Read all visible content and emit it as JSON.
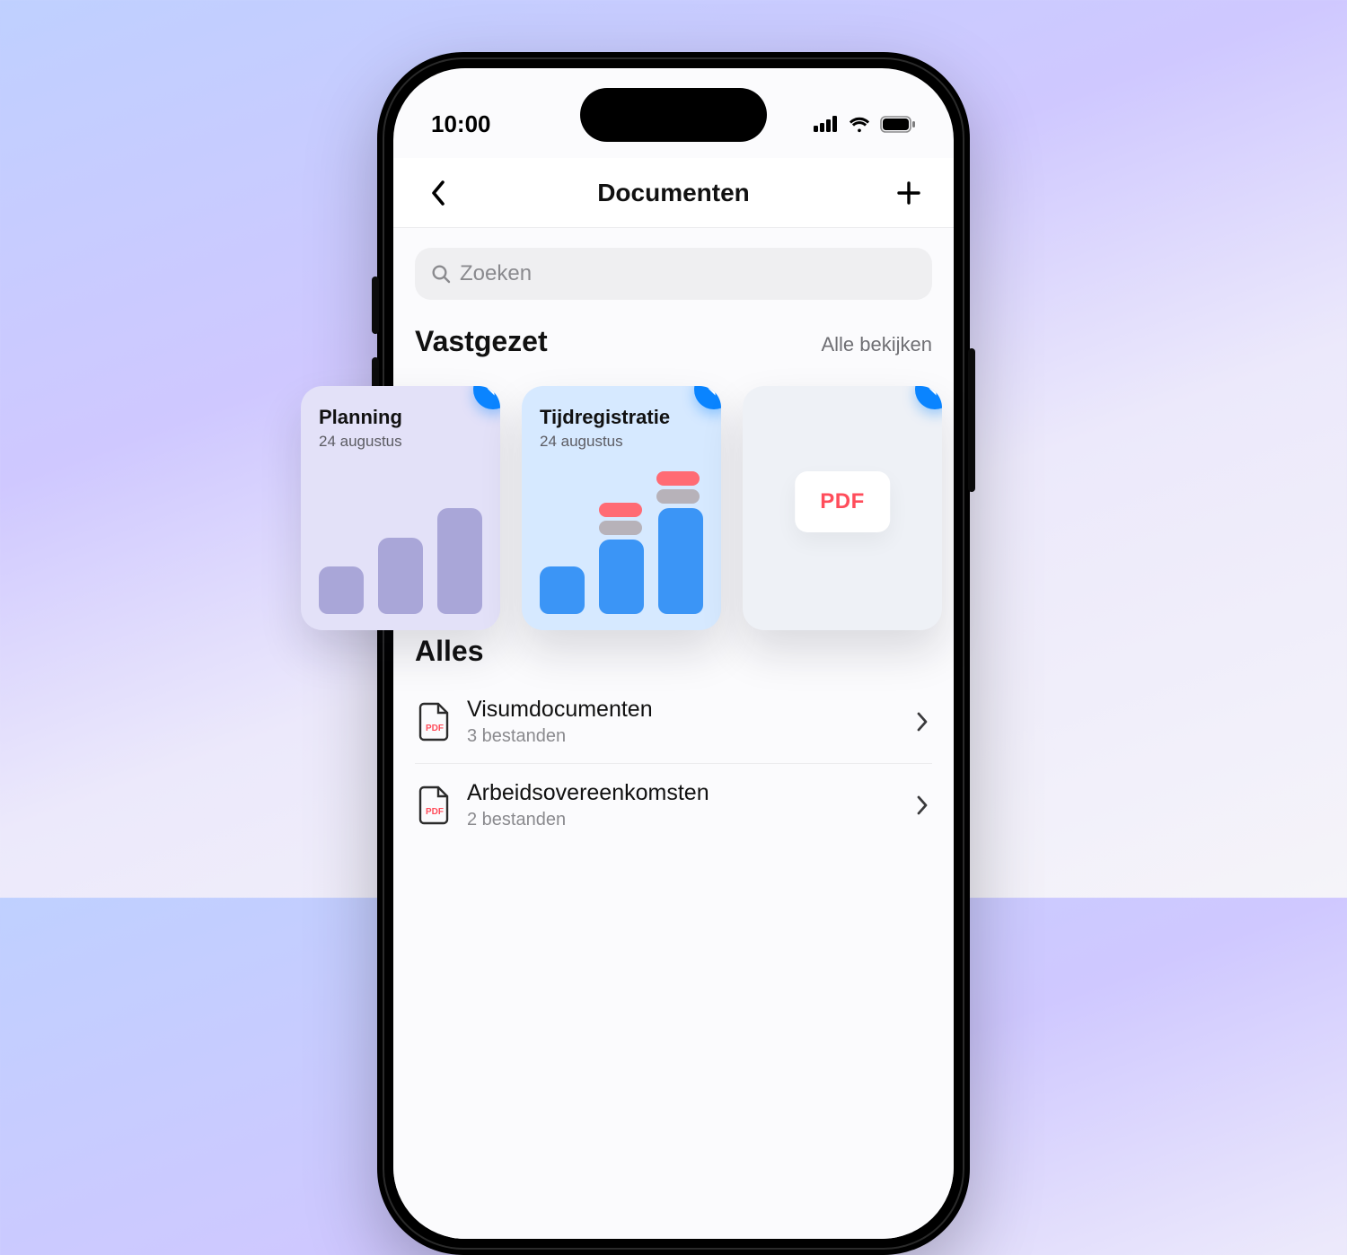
{
  "status": {
    "time": "10:00"
  },
  "nav": {
    "title": "Documenten"
  },
  "search": {
    "placeholder": "Zoeken"
  },
  "pinned": {
    "title": "Vastgezet",
    "view_all": "Alle bekijken",
    "cards": [
      {
        "title": "Planning",
        "date": "24 augustus"
      },
      {
        "title": "Tijdregistratie",
        "date": "24 augustus"
      },
      {
        "pdf_label": "PDF"
      }
    ]
  },
  "all": {
    "title": "Alles",
    "items": [
      {
        "title": "Visumdocumenten",
        "subtitle": "3 bestanden",
        "badge": "PDF"
      },
      {
        "title": "Arbeidsovereenkomsten",
        "subtitle": "2 bestanden",
        "badge": "PDF"
      }
    ]
  }
}
